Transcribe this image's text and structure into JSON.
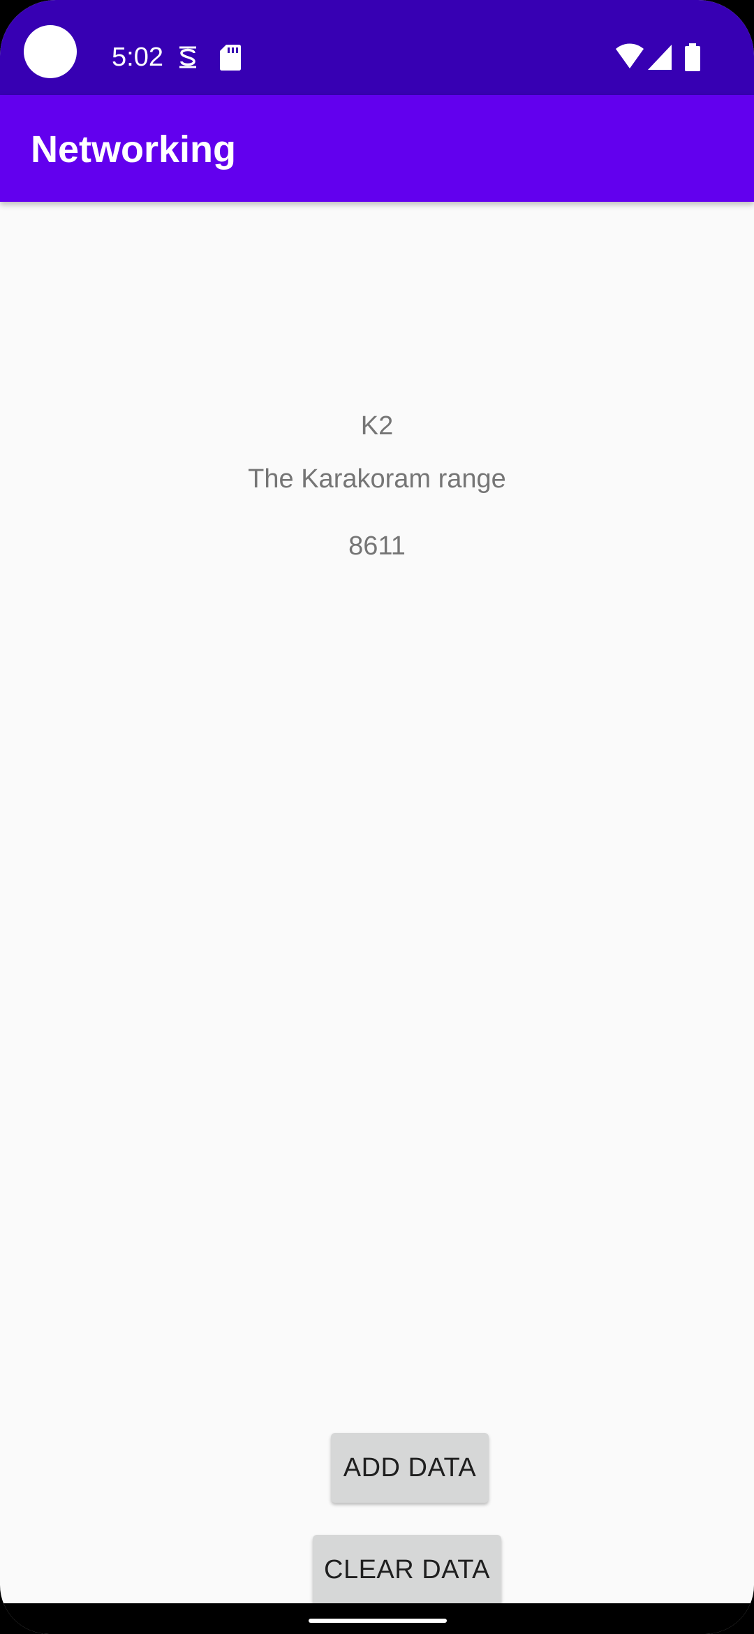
{
  "status_bar": {
    "time": "5:02",
    "background_color": "#3700b3",
    "icons": [
      "camera-cutout",
      "s-notification-icon",
      "sd-card-icon",
      "wifi-icon",
      "cell-signal-icon",
      "battery-icon"
    ]
  },
  "app_bar": {
    "title": "Networking",
    "background_color": "#6200ee"
  },
  "content": {
    "name": "K2",
    "range": "The Karakoram range",
    "height": "8611"
  },
  "buttons": {
    "add_label": "ADD DATA",
    "clear_label": "CLEAR DATA"
  },
  "nav_bar": {
    "handle": "home-handle"
  }
}
